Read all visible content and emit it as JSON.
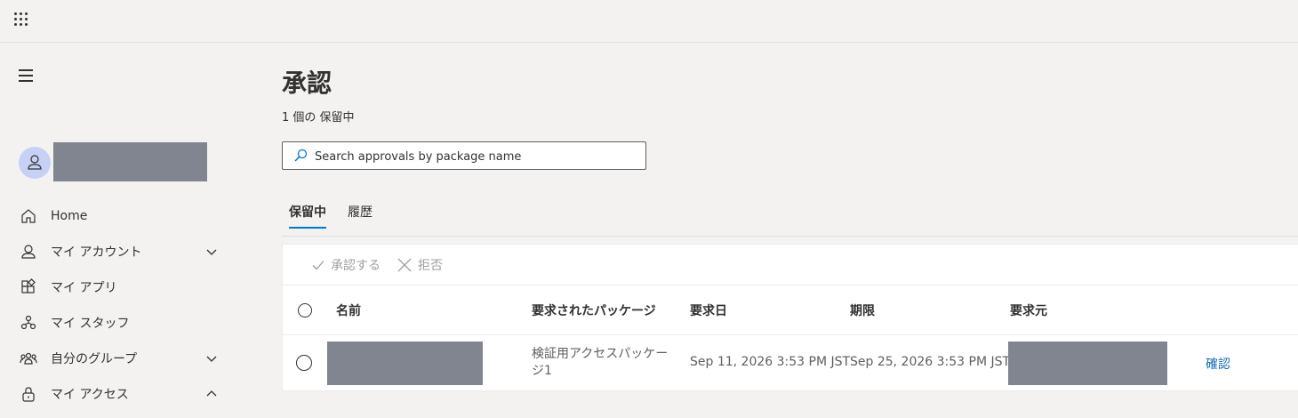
{
  "app": {
    "launcher_icon": "waffle-icon"
  },
  "sidebar": {
    "menu_icon": "hamburger-icon",
    "user": {
      "avatar_icon": "person-icon"
    },
    "items": [
      {
        "label": "Home",
        "icon": "home-icon",
        "expand": ""
      },
      {
        "label": "マイ アカウント",
        "icon": "person-icon",
        "expand": "chevron-down"
      },
      {
        "label": "マイ アプリ",
        "icon": "apps-icon",
        "expand": ""
      },
      {
        "label": "マイ スタッフ",
        "icon": "org-icon",
        "expand": ""
      },
      {
        "label": "自分のグループ",
        "icon": "people-icon",
        "expand": "chevron-down"
      },
      {
        "label": "マイ アクセス",
        "icon": "lock-icon",
        "expand": "chevron-up"
      }
    ]
  },
  "main": {
    "title": "承認",
    "pending_count": "1 個の 保留中",
    "search": {
      "placeholder": "Search approvals by package name",
      "value": ""
    },
    "tabs": [
      {
        "label": "保留中",
        "active": true
      },
      {
        "label": "履歴",
        "active": false
      }
    ],
    "commands": [
      {
        "label": "承認する",
        "icon": "checkmark-icon",
        "enabled": false
      },
      {
        "label": "拒否",
        "icon": "close-icon",
        "enabled": false
      }
    ],
    "table": {
      "columns": [
        "名前",
        "要求されたパッケージ",
        "要求日",
        "期限",
        "要求元"
      ],
      "rows": [
        {
          "package_line1": "検証用アクセスパッケー",
          "package_line2": "ジ1",
          "requested_date": "Sep 11, 2026 3:53 PM JST",
          "due_date": "Sep 25, 2026 3:53 PM JST",
          "action": "確認"
        }
      ]
    }
  },
  "colors": {
    "accent": "#0078d4",
    "link": "#0f6cbd",
    "redaction": "#808590",
    "background": "#f3f2f1"
  }
}
